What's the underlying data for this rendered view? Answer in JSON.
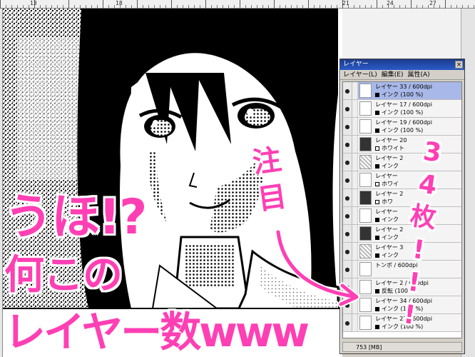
{
  "ruler": {
    "labels": [
      "13",
      "18",
      "21",
      "24",
      "27"
    ]
  },
  "palette": {
    "title": "レイヤー",
    "close_glyph": "×",
    "menu": [
      "レイヤー(L)",
      "編集(E)",
      "属性(A)"
    ],
    "status": "753 [MB]",
    "layers": [
      {
        "name": "レイヤー 33 / 600dpi",
        "mode": "インク (100 %)",
        "swatch": "black",
        "thumb": "light",
        "selected": true
      },
      {
        "name": "レイヤー 17 / 600dpi",
        "mode": "インク (100 %)",
        "swatch": "black",
        "thumb": "light"
      },
      {
        "name": "レイヤー 19 / 600dpi",
        "mode": "インク (100 %)",
        "swatch": "black",
        "thumb": "light"
      },
      {
        "name": "レイヤー 20",
        "mode": "ホワイト",
        "swatch": "white",
        "thumb": "dark"
      },
      {
        "name": "レイヤー 2",
        "mode": "インク",
        "swatch": "black",
        "thumb": "mid"
      },
      {
        "name": "レイヤー",
        "mode": "ホワイ",
        "swatch": "white",
        "thumb": "light"
      },
      {
        "name": "レイヤー 2",
        "mode": "ホワ",
        "swatch": "white",
        "thumb": "dark"
      },
      {
        "name": "レイヤー",
        "mode": "インク",
        "swatch": "black",
        "thumb": "light"
      },
      {
        "name": "レイヤー 2",
        "mode": "インク",
        "swatch": "black",
        "thumb": "dark"
      },
      {
        "name": "レイヤー 3",
        "mode": "インク",
        "swatch": "black",
        "thumb": "mid"
      },
      {
        "name": "トンボ / 600dpi",
        "mode": "",
        "swatch": "",
        "thumb": "light"
      },
      {
        "name": "レイヤー 2 / 600dpi",
        "mode": "反転 (100 %)",
        "swatch": "black",
        "thumb": "light"
      },
      {
        "name": "レイヤー 34 / 600dpi",
        "mode": "インク (100 %)",
        "swatch": "black",
        "thumb": "light"
      },
      {
        "name": "レイヤー 21 / 600dpi",
        "mode": "インク (100 %)",
        "swatch": "black",
        "thumb": "light"
      }
    ]
  },
  "overlay": {
    "line1": "うほ!?",
    "line2": "何この",
    "line3": "レイヤー数www",
    "vertical_note": "注目",
    "count_note": "34枚!!!"
  },
  "colors": {
    "overlay_pink": "#ff3fb4",
    "selected_layer": "#a8b8e8",
    "title_bar": "#2a5ac8"
  }
}
